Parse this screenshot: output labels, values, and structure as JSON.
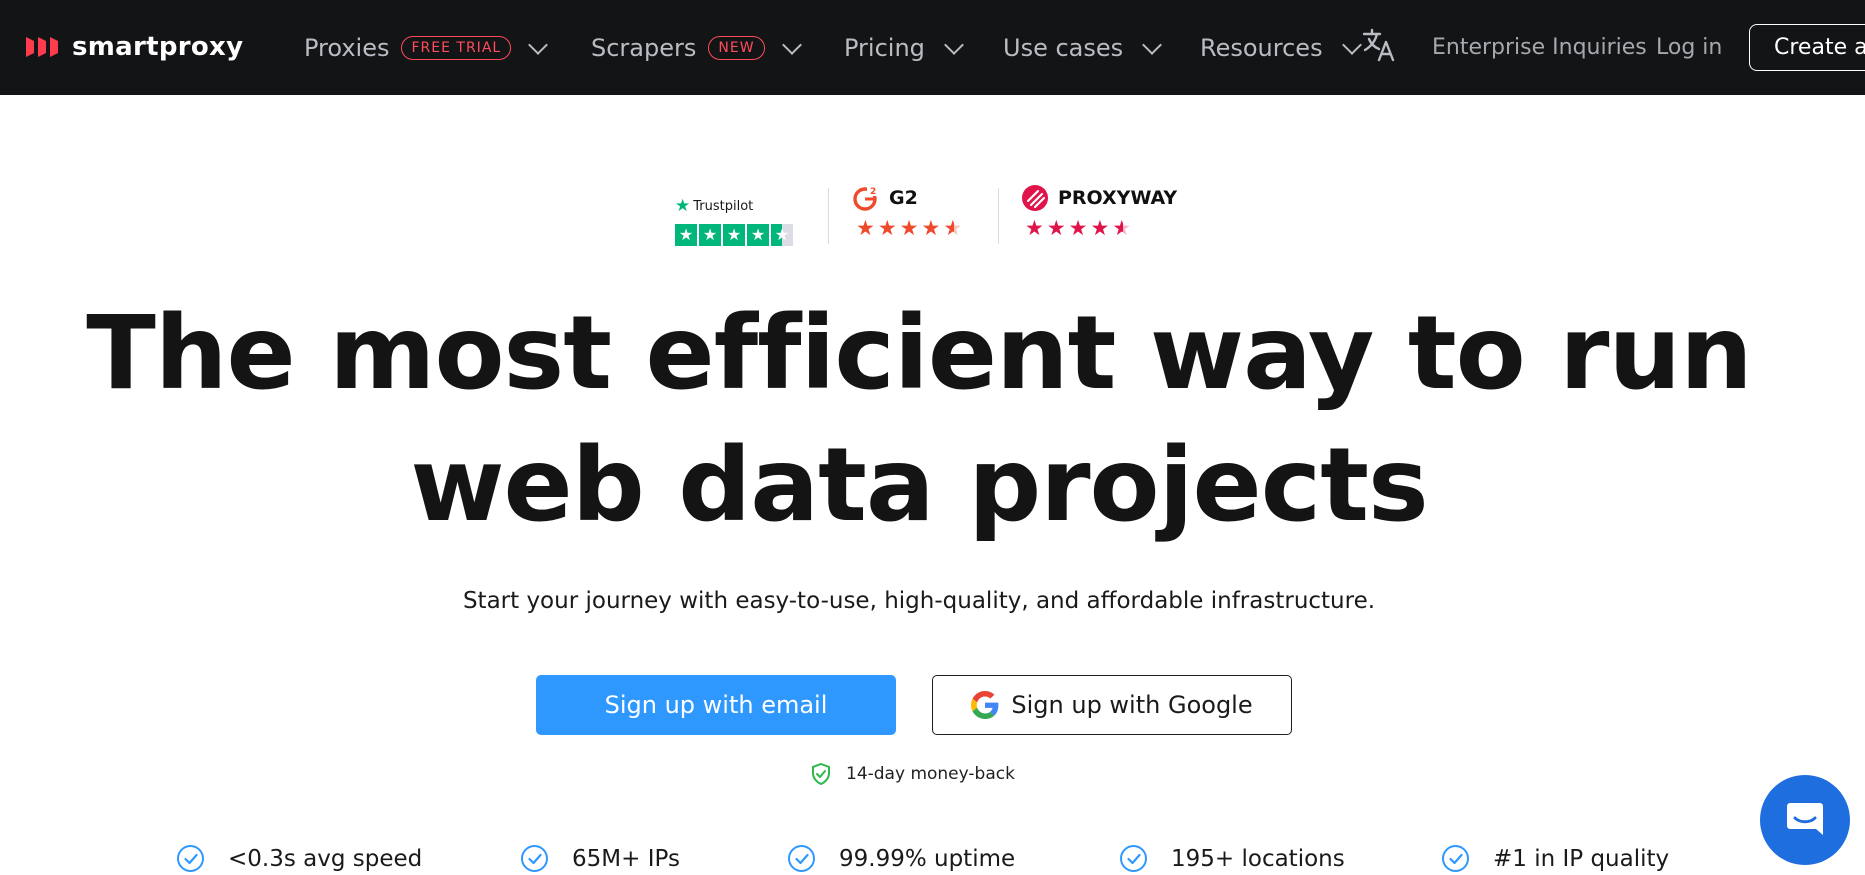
{
  "nav": {
    "logo_text": "smartproxy",
    "items": [
      {
        "label": "Proxies",
        "badge": "FREE TRIAL"
      },
      {
        "label": "Scrapers",
        "badge": "NEW"
      },
      {
        "label": "Pricing"
      },
      {
        "label": "Use cases"
      },
      {
        "label": "Resources"
      }
    ],
    "enterprise_label": "Enterprise Inquiries",
    "login_label": "Log in",
    "create_label": "Create account"
  },
  "ratings": {
    "trustpilot": "Trustpilot",
    "g2": "G2",
    "proxyway": "PROXYWAY",
    "g2_stars": 4.5,
    "proxyway_stars": 4.5,
    "trustpilot_stars": 4.5
  },
  "hero": {
    "title_line1": "The most efficient way to run",
    "title_line2": "web data projects",
    "subtitle": "Start your journey with easy-to-use, high-quality, and affordable infrastructure.",
    "email_button": "Sign up with email",
    "google_button": "Sign up with Google",
    "moneyback": "14-day money-back"
  },
  "features": [
    "<0.3s avg speed",
    "65M+ IPs",
    "99.99% uptime",
    "195+ locations",
    "#1 in IP quality"
  ],
  "colors": {
    "nav_bg": "#131416",
    "accent_red": "#ff4b5c",
    "accent_blue": "#2f98ff",
    "trustpilot_green": "#00b67a",
    "g2_orange": "#ef4a2b",
    "proxyway_red": "#e0134a"
  }
}
